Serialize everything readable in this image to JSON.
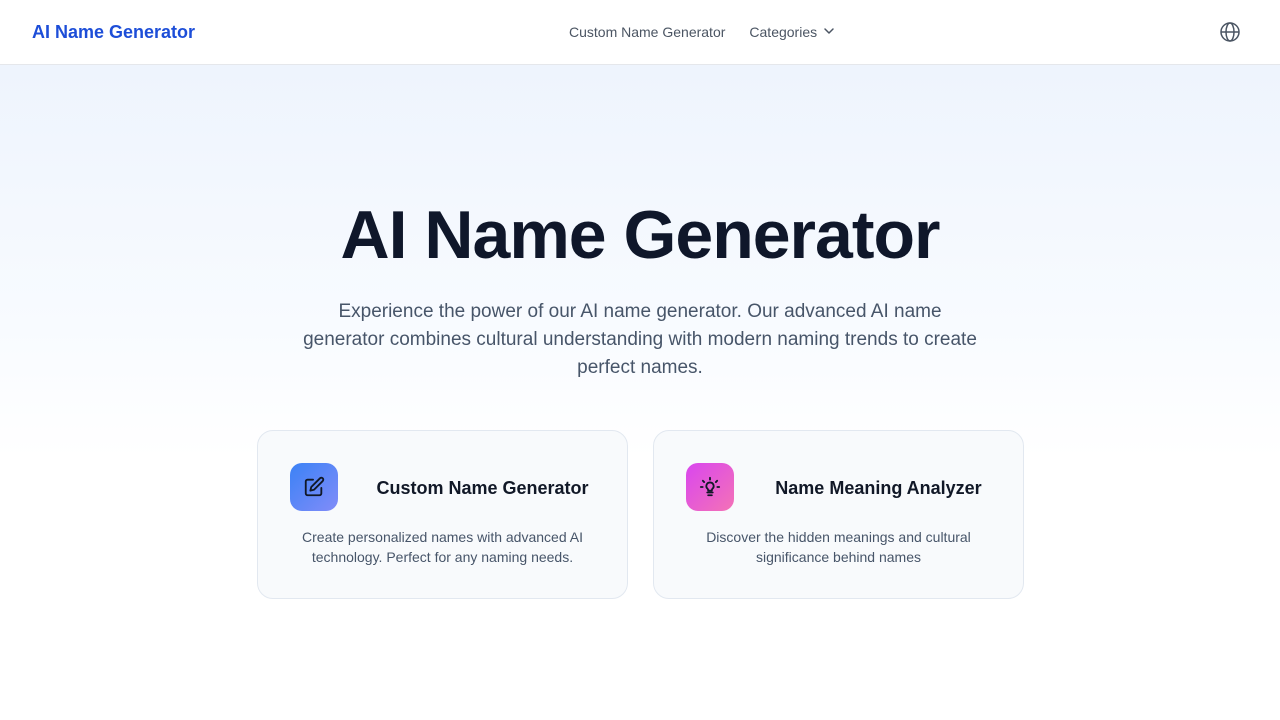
{
  "header": {
    "brand": "AI Name Generator",
    "nav": {
      "custom_link": "Custom Name Generator",
      "categories_label": "Categories"
    },
    "language_icon": "globe-icon"
  },
  "hero": {
    "title": "AI Name Generator",
    "subtitle": "Experience the power of our AI name generator. Our advanced AI name generator combines cultural understanding with modern naming trends to create perfect names."
  },
  "cards": [
    {
      "icon": "edit-icon",
      "title": "Custom Name Generator",
      "description": "Create personalized names with advanced AI technology. Perfect for any naming needs."
    },
    {
      "icon": "lightbulb-icon",
      "title": "Name Meaning Analyzer",
      "description": "Discover the hidden meanings and cultural significance behind names"
    }
  ],
  "colors": {
    "brand": "#1d4ed8",
    "title": "#0f172a",
    "card1_gradient": [
      "#3b82f6",
      "#818cf8"
    ],
    "card2_gradient": [
      "#d946ef",
      "#f472b6"
    ]
  }
}
